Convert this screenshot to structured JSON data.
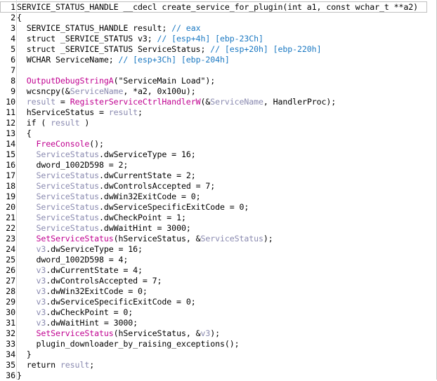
{
  "colors": {
    "text": "#000000",
    "comment": "#1a78c2",
    "function": "#c00090",
    "variable": "#8a8ab0",
    "background": "#ffffff"
  },
  "code": {
    "lines": [
      {
        "n": "1",
        "tokens": [
          [
            "t",
            "SERVICE_STATUS_HANDLE __cdecl create_service_for_plugin(int a1, const wchar_t **a2)"
          ]
        ]
      },
      {
        "n": "2",
        "tokens": [
          [
            "t",
            "{"
          ]
        ]
      },
      {
        "n": "3",
        "tokens": [
          [
            "t",
            "  SERVICE_STATUS_HANDLE result; "
          ],
          [
            "c",
            "// eax"
          ]
        ]
      },
      {
        "n": "4",
        "tokens": [
          [
            "t",
            "  struct _SERVICE_STATUS v3; "
          ],
          [
            "c",
            "// [esp+4h] [ebp-23Ch]"
          ]
        ]
      },
      {
        "n": "5",
        "tokens": [
          [
            "t",
            "  struct _SERVICE_STATUS ServiceStatus; "
          ],
          [
            "c",
            "// [esp+20h] [ebp-220h]"
          ]
        ]
      },
      {
        "n": "6",
        "tokens": [
          [
            "t",
            "  WCHAR ServiceName; "
          ],
          [
            "c",
            "// [esp+3Ch] [ebp-204h]"
          ]
        ]
      },
      {
        "n": "7",
        "tokens": [
          [
            "t",
            ""
          ]
        ]
      },
      {
        "n": "8",
        "tokens": [
          [
            "t",
            "  "
          ],
          [
            "f",
            "OutputDebugStringA"
          ],
          [
            "t",
            "(\"ServiceMain Load\");"
          ]
        ]
      },
      {
        "n": "9",
        "tokens": [
          [
            "t",
            "  wcsncpy(&"
          ],
          [
            "v",
            "ServiceName"
          ],
          [
            "t",
            ", *a2, 0x100u);"
          ]
        ]
      },
      {
        "n": "10",
        "tokens": [
          [
            "t",
            "  "
          ],
          [
            "v",
            "result"
          ],
          [
            "t",
            " = "
          ],
          [
            "f",
            "RegisterServiceCtrlHandlerW"
          ],
          [
            "t",
            "(&"
          ],
          [
            "v",
            "ServiceName"
          ],
          [
            "t",
            ", HandlerProc);"
          ]
        ]
      },
      {
        "n": "11",
        "tokens": [
          [
            "t",
            "  hServiceStatus = "
          ],
          [
            "v",
            "result"
          ],
          [
            "t",
            ";"
          ]
        ]
      },
      {
        "n": "12",
        "tokens": [
          [
            "t",
            "  if ( "
          ],
          [
            "v",
            "result"
          ],
          [
            "t",
            " )"
          ]
        ]
      },
      {
        "n": "13",
        "tokens": [
          [
            "t",
            "  {"
          ]
        ]
      },
      {
        "n": "14",
        "tokens": [
          [
            "t",
            "    "
          ],
          [
            "f",
            "FreeConsole"
          ],
          [
            "t",
            "();"
          ]
        ]
      },
      {
        "n": "15",
        "tokens": [
          [
            "t",
            "    "
          ],
          [
            "v",
            "ServiceStatus"
          ],
          [
            "t",
            ".dwServiceType = 16;"
          ]
        ]
      },
      {
        "n": "16",
        "tokens": [
          [
            "t",
            "    dword_1002D598 = 2;"
          ]
        ]
      },
      {
        "n": "17",
        "tokens": [
          [
            "t",
            "    "
          ],
          [
            "v",
            "ServiceStatus"
          ],
          [
            "t",
            ".dwCurrentState = 2;"
          ]
        ]
      },
      {
        "n": "18",
        "tokens": [
          [
            "t",
            "    "
          ],
          [
            "v",
            "ServiceStatus"
          ],
          [
            "t",
            ".dwControlsAccepted = 7;"
          ]
        ]
      },
      {
        "n": "19",
        "tokens": [
          [
            "t",
            "    "
          ],
          [
            "v",
            "ServiceStatus"
          ],
          [
            "t",
            ".dwWin32ExitCode = 0;"
          ]
        ]
      },
      {
        "n": "20",
        "tokens": [
          [
            "t",
            "    "
          ],
          [
            "v",
            "ServiceStatus"
          ],
          [
            "t",
            ".dwServiceSpecificExitCode = 0;"
          ]
        ]
      },
      {
        "n": "21",
        "tokens": [
          [
            "t",
            "    "
          ],
          [
            "v",
            "ServiceStatus"
          ],
          [
            "t",
            ".dwCheckPoint = 1;"
          ]
        ]
      },
      {
        "n": "22",
        "tokens": [
          [
            "t",
            "    "
          ],
          [
            "v",
            "ServiceStatus"
          ],
          [
            "t",
            ".dwWaitHint = 3000;"
          ]
        ]
      },
      {
        "n": "23",
        "tokens": [
          [
            "t",
            "    "
          ],
          [
            "f",
            "SetServiceStatus"
          ],
          [
            "t",
            "(hServiceStatus, &"
          ],
          [
            "v",
            "ServiceStatus"
          ],
          [
            "t",
            ");"
          ]
        ]
      },
      {
        "n": "24",
        "tokens": [
          [
            "t",
            "    "
          ],
          [
            "v",
            "v3"
          ],
          [
            "t",
            ".dwServiceType = 16;"
          ]
        ]
      },
      {
        "n": "25",
        "tokens": [
          [
            "t",
            "    dword_1002D598 = 4;"
          ]
        ]
      },
      {
        "n": "26",
        "tokens": [
          [
            "t",
            "    "
          ],
          [
            "v",
            "v3"
          ],
          [
            "t",
            ".dwCurrentState = 4;"
          ]
        ]
      },
      {
        "n": "27",
        "tokens": [
          [
            "t",
            "    "
          ],
          [
            "v",
            "v3"
          ],
          [
            "t",
            ".dwControlsAccepted = 7;"
          ]
        ]
      },
      {
        "n": "28",
        "tokens": [
          [
            "t",
            "    "
          ],
          [
            "v",
            "v3"
          ],
          [
            "t",
            ".dwWin32ExitCode = 0;"
          ]
        ]
      },
      {
        "n": "29",
        "tokens": [
          [
            "t",
            "    "
          ],
          [
            "v",
            "v3"
          ],
          [
            "t",
            ".dwServiceSpecificExitCode = 0;"
          ]
        ]
      },
      {
        "n": "30",
        "tokens": [
          [
            "t",
            "    "
          ],
          [
            "v",
            "v3"
          ],
          [
            "t",
            ".dwCheckPoint = 0;"
          ]
        ]
      },
      {
        "n": "31",
        "tokens": [
          [
            "t",
            "    "
          ],
          [
            "v",
            "v3"
          ],
          [
            "t",
            ".dwWaitHint = 3000;"
          ]
        ]
      },
      {
        "n": "32",
        "tokens": [
          [
            "t",
            "    "
          ],
          [
            "f",
            "SetServiceStatus"
          ],
          [
            "t",
            "(hServiceStatus, &"
          ],
          [
            "v",
            "v3"
          ],
          [
            "t",
            ");"
          ]
        ]
      },
      {
        "n": "33",
        "tokens": [
          [
            "t",
            "    plugin_downloader_by_raising_exceptions();"
          ]
        ]
      },
      {
        "n": "34",
        "tokens": [
          [
            "t",
            "  }"
          ]
        ]
      },
      {
        "n": "35",
        "tokens": [
          [
            "t",
            "  return "
          ],
          [
            "v",
            "result"
          ],
          [
            "t",
            ";"
          ]
        ]
      },
      {
        "n": "36",
        "tokens": [
          [
            "t",
            "}"
          ]
        ]
      }
    ]
  }
}
